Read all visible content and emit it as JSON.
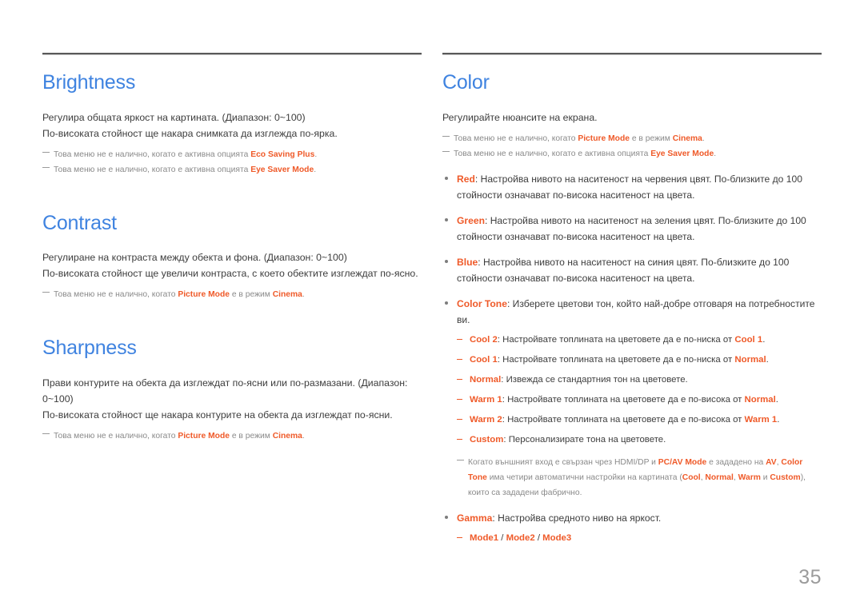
{
  "page": {
    "number": "35",
    "accent_color": "#ef5a29",
    "heading_color": "#3f83e0",
    "background": "#ffffff"
  },
  "left_column": {
    "sections": [
      {
        "title": "Brightness",
        "paragraphs": [
          "Регулира общата яркост на картината. (Диапазон: 0~100)",
          "По-високата стойност ще накара снимката да изглежда по-ярка."
        ],
        "notes": [
          {
            "parts": [
              {
                "text": "Това меню не е налично, когато е активна опцията ",
                "accent": false
              },
              {
                "text": "Eco Saving Plus",
                "accent": true
              },
              {
                "text": ".",
                "accent": false
              }
            ]
          },
          {
            "parts": [
              {
                "text": "Това меню не е налично, когато е активна опцията ",
                "accent": false
              },
              {
                "text": "Eye Saver Mode",
                "accent": true
              },
              {
                "text": ".",
                "accent": false
              }
            ]
          }
        ]
      },
      {
        "title": "Contrast",
        "paragraphs": [
          "Регулиране на контраста между обекта и фона. (Диапазон: 0~100)",
          "По-високата стойност ще увеличи контраста, с което обектите изглеждат по-ясно."
        ],
        "notes": [
          {
            "parts": [
              {
                "text": "Това меню не е налично, когато ",
                "accent": false
              },
              {
                "text": "Picture Mode",
                "accent": true
              },
              {
                "text": " е в режим ",
                "accent": false
              },
              {
                "text": "Cinema",
                "accent": true
              },
              {
                "text": ".",
                "accent": false
              }
            ]
          }
        ]
      },
      {
        "title": "Sharpness",
        "paragraphs": [
          "Прави контурите на обекта да изглеждат по-ясни или по-размазани. (Диапазон: 0~100)",
          "По-високата стойност ще накара контурите на обекта да изглеждат по-ясни."
        ],
        "notes": [
          {
            "parts": [
              {
                "text": "Това меню не е налично, когато ",
                "accent": false
              },
              {
                "text": "Picture Mode",
                "accent": true
              },
              {
                "text": " е в режим ",
                "accent": false
              },
              {
                "text": "Cinema",
                "accent": true
              },
              {
                "text": ".",
                "accent": false
              }
            ]
          }
        ]
      }
    ]
  },
  "right_column": {
    "section": {
      "title": "Color",
      "paragraphs": [
        "Регулирайте нюансите на екрана."
      ],
      "notes": [
        {
          "parts": [
            {
              "text": "Това меню не е налично, когато ",
              "accent": false
            },
            {
              "text": "Picture Mode",
              "accent": true
            },
            {
              "text": " е в режим ",
              "accent": false
            },
            {
              "text": "Cinema",
              "accent": true
            },
            {
              "text": ".",
              "accent": false
            }
          ]
        },
        {
          "parts": [
            {
              "text": "Това меню не е налично, когато е активна опцията ",
              "accent": false
            },
            {
              "text": "Eye Saver Mode",
              "accent": true
            },
            {
              "text": ".",
              "accent": false
            }
          ]
        }
      ],
      "bullets": [
        {
          "label": "Red",
          "separator": ": ",
          "text": "Настройва нивото на наситеност на червения цвят. По-близките до 100 стойности означават по-висока наситеност на цвета."
        },
        {
          "label": "Green",
          "separator": ": ",
          "text": "Настройва нивото на наситеност на зеления цвят. По-близките до 100 стойности означават по-висока наситеност на цвета."
        },
        {
          "label": "Blue",
          "separator": ": ",
          "text": "Настройва нивото на наситеност на синия цвят. По-близките до 100 стойности означават по-висока наситеност на цвета."
        },
        {
          "label": "Color Tone",
          "separator": ": ",
          "text": "Изберете цветови тон, който най-добре отговаря на потребностите ви.",
          "subs": [
            {
              "parts": [
                {
                  "text": "Cool 2",
                  "accent": true
                },
                {
                  "text": ": Настройвате топлината на цветовете да е по-ниска от ",
                  "accent": false
                },
                {
                  "text": "Cool 1",
                  "accent": true
                },
                {
                  "text": ".",
                  "accent": false
                }
              ]
            },
            {
              "parts": [
                {
                  "text": "Cool 1",
                  "accent": true
                },
                {
                  "text": ": Настройвате топлината на цветовете да е по-ниска от ",
                  "accent": false
                },
                {
                  "text": "Normal",
                  "accent": true
                },
                {
                  "text": ".",
                  "accent": false
                }
              ]
            },
            {
              "parts": [
                {
                  "text": "Normal",
                  "accent": true
                },
                {
                  "text": ": Извежда се стандартния тон на цветовете.",
                  "accent": false
                }
              ]
            },
            {
              "parts": [
                {
                  "text": "Warm 1",
                  "accent": true
                },
                {
                  "text": ": Настройвате топлината на цветовете да е по-висока от ",
                  "accent": false
                },
                {
                  "text": "Normal",
                  "accent": true
                },
                {
                  "text": ".",
                  "accent": false
                }
              ]
            },
            {
              "parts": [
                {
                  "text": "Warm 2",
                  "accent": true
                },
                {
                  "text": ": Настройвате топлината на цветовете да е по-висока от ",
                  "accent": false
                },
                {
                  "text": "Warm 1",
                  "accent": true
                },
                {
                  "text": ".",
                  "accent": false
                }
              ]
            },
            {
              "parts": [
                {
                  "text": "Custom",
                  "accent": true
                },
                {
                  "text": ": Персонализирате тона на цветовете.",
                  "accent": false
                }
              ]
            }
          ],
          "note": {
            "parts": [
              {
                "text": "Когато външният вход е свързан чрез HDMI/DP и ",
                "accent": false
              },
              {
                "text": "PC/AV Mode",
                "accent": true
              },
              {
                "text": " е зададено на ",
                "accent": false
              },
              {
                "text": "AV",
                "accent": true
              },
              {
                "text": ", ",
                "accent": false
              },
              {
                "text": "Color Tone",
                "accent": true
              },
              {
                "text": " има четири автоматични настройки на картината (",
                "accent": false
              },
              {
                "text": "Cool",
                "accent": true
              },
              {
                "text": ", ",
                "accent": false
              },
              {
                "text": "Normal",
                "accent": true
              },
              {
                "text": ", ",
                "accent": false
              },
              {
                "text": "Warm",
                "accent": true
              },
              {
                "text": " и ",
                "accent": false
              },
              {
                "text": "Custom",
                "accent": true
              },
              {
                "text": "), които са зададени фабрично.",
                "accent": false
              }
            ]
          }
        },
        {
          "label": "Gamma",
          "separator": ": ",
          "text": "Настройва средното ниво на яркост.",
          "subs": [
            {
              "parts": [
                {
                  "text": "Mode1",
                  "accent": true
                },
                {
                  "text": " / ",
                  "accent": false
                },
                {
                  "text": "Mode2",
                  "accent": true
                },
                {
                  "text": " / ",
                  "accent": false
                },
                {
                  "text": "Mode3",
                  "accent": true
                }
              ]
            }
          ]
        }
      ]
    }
  }
}
